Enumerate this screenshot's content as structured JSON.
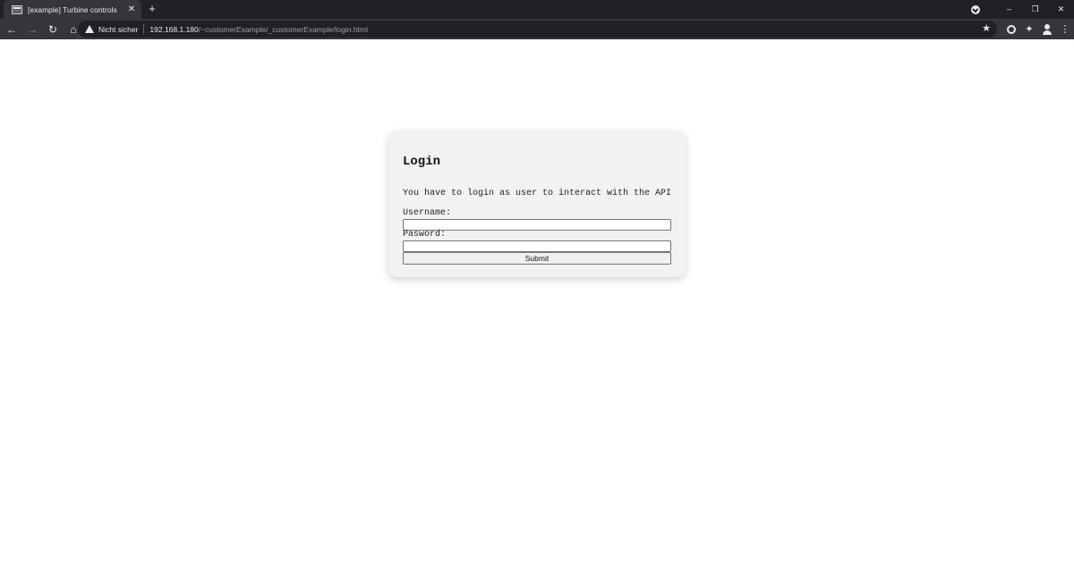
{
  "browser": {
    "tab_title": "[example] Turbine controls",
    "tab_close_icon": "close-icon",
    "new_tab_glyph": "+",
    "window_controls": {
      "minimize": "–",
      "restore": "❐",
      "close": "✕"
    },
    "nav": {
      "back": "←",
      "forward": "→",
      "reload": "↻",
      "home": "⌂"
    },
    "omnibox": {
      "security_label": "Nicht sicher",
      "url_host": "192.168.1.180",
      "url_path": "/~customerExample/_customerExample/login.html"
    },
    "icons": {
      "star": "★",
      "puzzle": "✦"
    }
  },
  "login": {
    "title": "Login",
    "description": "You have to login as user to interact with the API",
    "username_label": "Username:",
    "username_value": "",
    "password_label": "Pasword:",
    "password_value": "",
    "submit_label": "Submit"
  },
  "colors": {
    "tabstrip_bg": "#202124",
    "toolbar_bg": "#35363a",
    "card_bg": "#f2f2f2"
  }
}
